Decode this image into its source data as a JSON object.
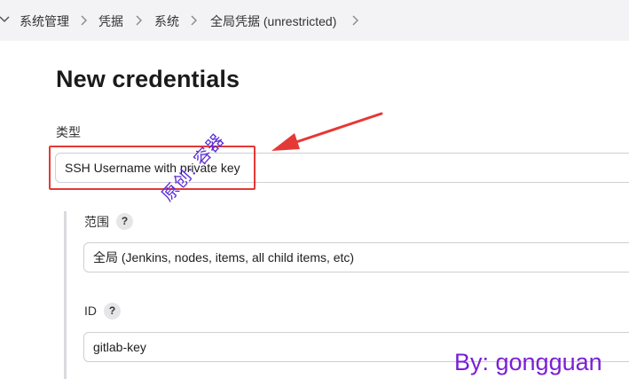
{
  "breadcrumb": {
    "items": [
      "系统管理",
      "凭据",
      "系统",
      "全局凭据 (unrestricted)"
    ]
  },
  "page": {
    "title": "New credentials"
  },
  "form": {
    "type_label": "类型",
    "type_value": "SSH Username with private key",
    "scope_label": "范围",
    "scope_help": "?",
    "scope_value": "全局 (Jenkins, nodes, items, all child items, etc)",
    "id_label": "ID",
    "id_help": "?",
    "id_value": "gitlab-key"
  },
  "annotation": {
    "highlight_color": "#e53935",
    "arrow_color": "#e53935"
  },
  "watermarks": {
    "chinese": "原创: 容器",
    "author": "By: gongguan"
  },
  "colors": {
    "breadcrumb_bg": "#f3f3f5",
    "watermark_purple": "#7a1fd6"
  }
}
